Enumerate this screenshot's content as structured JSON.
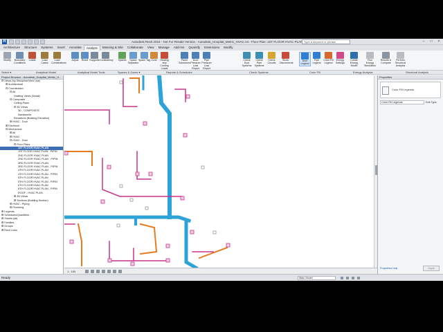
{
  "window": {
    "app_logo": "R",
    "title": "Autodesk Revit 2016 - Not For Resale Version - Autodesk_Hospital_Metric_HVAC.rvt - Floor Plan: 1ST FLOOR HVAC PLAN",
    "search_placeholder": "Type a keyword or phrase",
    "minimize": "–",
    "maximize": "□",
    "close": "×"
  },
  "tabs": [
    "Architecture",
    "Structure",
    "Systems",
    "Insert",
    "Annotate",
    "Analyze",
    "Massing & Site",
    "Collaborate",
    "View",
    "Manage",
    "Add-Ins",
    "Quantify",
    "Extensions",
    "Modify"
  ],
  "active_tab": "Analyze",
  "ribbon": {
    "buttons": [
      {
        "label": "Modify",
        "color": "#9aa6b2"
      },
      {
        "label": "Boundary Conditions",
        "color": "#6e8fb5"
      },
      {
        "label": "Loads",
        "color": "#c0503a"
      },
      {
        "label": "Load Cases",
        "color": "#9c7b3c"
      },
      {
        "label": "Load Combinations",
        "color": "#9c7b3c"
      },
      {
        "label": "Adjust",
        "color": "#5b8ec2"
      },
      {
        "label": "Reset",
        "color": "#5b8ec2"
      },
      {
        "label": "Supports",
        "color": "#7b8a9a"
      },
      {
        "label": "Consistency",
        "color": "#7b8a9a"
      },
      {
        "label": "Spaces",
        "color": "#5fa35a"
      },
      {
        "label": "Space Separator",
        "color": "#6a9cd1"
      },
      {
        "label": "Space Tag",
        "color": "#6a9cd1"
      },
      {
        "label": "Zone",
        "color": "#d08a3a"
      },
      {
        "label": "Heating and Cooling Loads",
        "color": "#c94a3a"
      },
      {
        "label": "Panel Schedules",
        "color": "#4f7fb8"
      },
      {
        "label": "Duct Pressure Loss Report",
        "color": "#4f7fb8"
      },
      {
        "label": "Pipe Pressure Loss Report",
        "color": "#4f7fb8"
      },
      {
        "label": "Check Duct Systems",
        "color": "#3a8fb5"
      },
      {
        "label": "Check Pipe Systems",
        "color": "#3a8fb5"
      },
      {
        "label": "Check Circuits",
        "color": "#d6a72e"
      },
      {
        "label": "Show Disconnects",
        "color": "#c94a3a"
      },
      {
        "label": "Duct Legend",
        "color": "#2f7fd0"
      },
      {
        "label": "Pipe Legend",
        "color": "#2f7fd0"
      },
      {
        "label": "Color Fill Legend",
        "color": "#d66a2e"
      },
      {
        "label": "Energy Settings",
        "color": "#d04a8a"
      },
      {
        "label": "Create Energy Model",
        "color": "#2f6fb0"
      },
      {
        "label": "Run Energy Simulation",
        "color": "#b7bcc2"
      },
      {
        "label": "Results & Compare",
        "color": "#8a949e"
      },
      {
        "label": "Perform Structural Analysis",
        "color": "#b7bcc2"
      }
    ],
    "selected": "Duct Legend",
    "panels": [
      {
        "label": "Select ▾"
      },
      {
        "label": "Analytical Model"
      },
      {
        "label": "Analytical Model Tools"
      },
      {
        "label": "Spaces & Zones ▾"
      },
      {
        "label": "Reports & Schedules"
      },
      {
        "label": "Check Systems"
      },
      {
        "label": "Color Fill"
      },
      {
        "label": "Energy Analysis"
      },
      {
        "label": "Structural Analysis"
      }
    ]
  },
  "browser": {
    "title": "Project Browser - Autodesk_Hospital_Metric_H...",
    "items": [
      {
        "label": "⊟ Views (by Discipline/View Use)",
        "d": 0
      },
      {
        "label": "⊞ Architectural",
        "d": 1
      },
      {
        "label": "⊟ Coordination",
        "d": 1
      },
      {
        "label": "⊟ All",
        "d": 2
      },
      {
        "label": "Drafting Views (Detail)",
        "d": 3
      },
      {
        "label": "⊟ Composite",
        "d": 2
      },
      {
        "label": "Ceiling Plans",
        "d": 3
      },
      {
        "label": "⊟ 3D Views",
        "d": 3
      },
      {
        "label": "3D - COMPOSITE",
        "d": 4
      },
      {
        "label": "Navisworks",
        "d": 4
      },
      {
        "label": "Elevations (Building Elevation)",
        "d": 3
      },
      {
        "label": "⊞ HVAC - Duct",
        "d": 2
      },
      {
        "label": "⊞ Electrical",
        "d": 1
      },
      {
        "label": "⊟ Mechanical",
        "d": 1
      },
      {
        "label": "⊞ All",
        "d": 2
      },
      {
        "label": "⊞ HVAC",
        "d": 2
      },
      {
        "label": "⊟ HVAC - Duct",
        "d": 2
      },
      {
        "label": "⊟ Floor Plans",
        "d": 3
      },
      {
        "label": "1ST FLOOR HVAC PLAN",
        "d": 4,
        "sel": true
      },
      {
        "label": "1ST FLOOR HVAC PLAN - PIPIN",
        "d": 4
      },
      {
        "label": "2ND FLOOR HVAC PLAN",
        "d": 4
      },
      {
        "label": "2ND FLOOR HVAC PLAN - PIPIN",
        "d": 4
      },
      {
        "label": "3RD FLOOR HVAC PLAN",
        "d": 4
      },
      {
        "label": "3RD FLOOR HVAC PLAN - PIPIN",
        "d": 4
      },
      {
        "label": "4TH FLOOR HVAC PLAN",
        "d": 4
      },
      {
        "label": "4TH FLOOR HVAC PLAN - PIPIN",
        "d": 4
      },
      {
        "label": "5TH FLOOR HVAC PLAN",
        "d": 4
      },
      {
        "label": "5TH FLOOR HVAC PLAN - PIPIN",
        "d": 4
      },
      {
        "label": "6TH FLOOR HVAC PLAN",
        "d": 4
      },
      {
        "label": "6TH FLOOR HVAC PLAN - PIPIN",
        "d": 4
      },
      {
        "label": "ROOF - HVAC PLAN",
        "d": 4
      },
      {
        "label": "⊞ 3D Views",
        "d": 3
      },
      {
        "label": "⊞ Sections (Building Section)",
        "d": 3
      },
      {
        "label": "⊞ HVAC - Piping",
        "d": 2
      },
      {
        "label": "⊞ Plumbing",
        "d": 2
      },
      {
        "label": "⊞ Legends",
        "d": 0
      },
      {
        "label": "⊞ Schedules/Quantities",
        "d": 0
      },
      {
        "label": "⊞ Sheets (all)",
        "d": 0
      },
      {
        "label": "⊞ Families",
        "d": 0
      },
      {
        "label": "⊞ Groups",
        "d": 0
      },
      {
        "label": "⊞ Revit Links",
        "d": 0
      }
    ]
  },
  "properties": {
    "title": "Properties",
    "type_label": "Color Fill Legends",
    "selector": "Color Fill Legends",
    "edit_type": "Edit Type",
    "help": "Properties help",
    "apply": "Apply"
  },
  "viewbar": {
    "scale": "1 : 100"
  },
  "status": {
    "text": "Ready",
    "model": "Main Model"
  },
  "colors": {
    "duct": "#2ea3d8",
    "pipe_orange": "#e87a1e",
    "pipe_magenta": "#c8328c"
  }
}
